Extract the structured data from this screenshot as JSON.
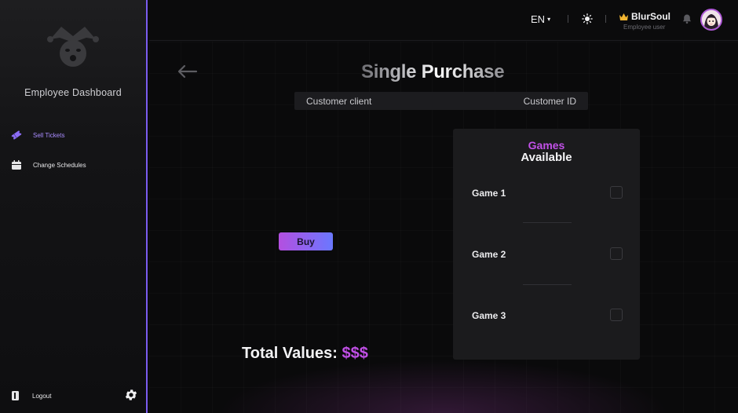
{
  "sidebar": {
    "brand": "Employee Dashboard",
    "items": [
      {
        "label": "Sell Tickets",
        "icon": "ticket-icon",
        "active": true
      },
      {
        "label": "Change Schedules",
        "icon": "calendar-icon",
        "active": false
      }
    ],
    "logout_label": "Logout",
    "accent": "#7b5cf0"
  },
  "topbar": {
    "language": "EN",
    "username": "BlurSoul",
    "role": "Employee user"
  },
  "main": {
    "title": "Single Purchase",
    "customer_client": "Customer client",
    "customer_id": "Customer ID",
    "buy_label": "Buy",
    "total_label": "Total Values:",
    "total_value": "$$$"
  },
  "games": {
    "heading_line1": "Games",
    "heading_line2": "Available",
    "items": [
      {
        "name": "Game 1",
        "checked": false
      },
      {
        "name": "Game 2",
        "checked": false
      },
      {
        "name": "Game 3",
        "checked": false
      }
    ]
  },
  "colors": {
    "accent_purple": "#c04fe6",
    "buy_gradient_start": "#b44fe0",
    "buy_gradient_end": "#6a78ff",
    "background": "#0b0b0c"
  }
}
